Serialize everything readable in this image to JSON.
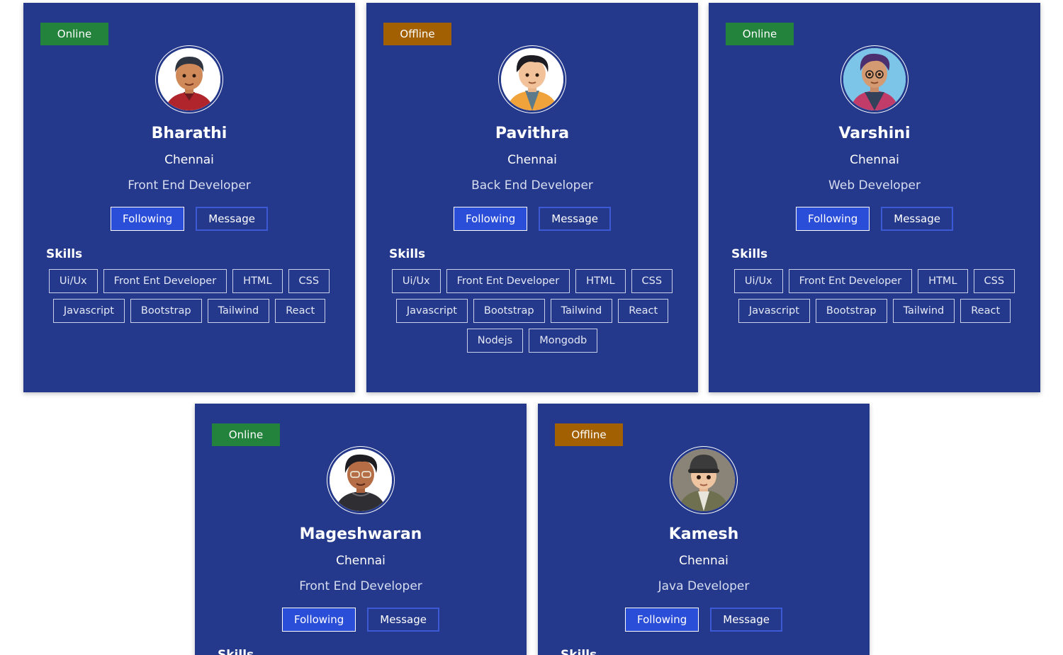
{
  "colors": {
    "card_bg": "#24398b",
    "online": "#23823b",
    "offline": "#a26002",
    "following_bg": "#2b4ed8",
    "message_border": "#3c5ad6"
  },
  "buttons": {
    "following_label": "Following",
    "message_label": "Message"
  },
  "skills_heading": "Skills",
  "profiles": [
    {
      "status": "Online",
      "name": "Bharathi",
      "city": "Chennai",
      "role": "Front End Developer",
      "avatar": "boy-avatar-red-jacket",
      "skills": [
        "Ui/Ux",
        "Front Ent Developer",
        "HTML",
        "CSS",
        "Javascript",
        "Bootstrap",
        "Tailwind",
        "React"
      ]
    },
    {
      "status": "Offline",
      "name": "Pavithra",
      "city": "Chennai",
      "role": "Back End Developer",
      "avatar": "boy-avatar-orange-jacket",
      "skills": [
        "Ui/Ux",
        "Front Ent Developer",
        "HTML",
        "CSS",
        "Javascript",
        "Bootstrap",
        "Tailwind",
        "React",
        "Nodejs",
        "Mongodb"
      ]
    },
    {
      "status": "Online",
      "name": "Varshini",
      "city": "Chennai",
      "role": "Web Developer",
      "avatar": "boy-avatar-glasses-blue",
      "skills": [
        "Ui/Ux",
        "Front Ent Developer",
        "HTML",
        "CSS",
        "Javascript",
        "Bootstrap",
        "Tailwind",
        "React"
      ]
    },
    {
      "status": "Online",
      "name": "Mageshwaran",
      "city": "Chennai",
      "role": "Front End Developer",
      "avatar": "boy-avatar-glasses-grey",
      "skills": [
        "Skills"
      ]
    },
    {
      "status": "Offline",
      "name": "Kamesh",
      "city": "Chennai",
      "role": "Java Developer",
      "avatar": "boy-avatar-cap",
      "skills": []
    }
  ]
}
